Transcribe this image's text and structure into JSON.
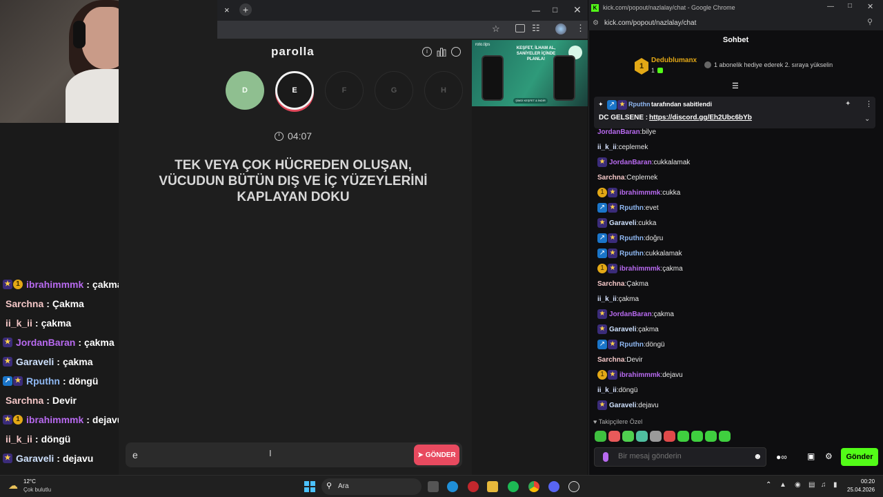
{
  "overlay_chat": [
    {
      "badges": [
        "star",
        "gold"
      ],
      "user": "ibrahimmmk",
      "color": "#b86af0",
      "message": "çakma"
    },
    {
      "badges": [],
      "user": "Sarchna",
      "color": "#f4c7c7",
      "message": "Çakma"
    },
    {
      "badges": [],
      "user": "ii_k_ii",
      "color": "#f4c7c7",
      "message": "çakma"
    },
    {
      "badges": [
        "star"
      ],
      "user": "JordanBaran",
      "color": "#b86af0",
      "message": "çakma"
    },
    {
      "badges": [
        "star"
      ],
      "user": "Garaveli",
      "color": "#cfe2ff",
      "message": "çakma"
    },
    {
      "badges": [
        "pin",
        "star"
      ],
      "user": "Rputhn",
      "color": "#8fb8f2",
      "message": "döngü"
    },
    {
      "badges": [],
      "user": "Sarchna",
      "color": "#f4c7c7",
      "message": "Devir"
    },
    {
      "badges": [
        "star",
        "gold"
      ],
      "user": "ibrahimmmk",
      "color": "#b86af0",
      "message": "dejavu"
    },
    {
      "badges": [],
      "user": "ii_k_ii",
      "color": "#f4c7c7",
      "message": "döngü"
    },
    {
      "badges": [
        "star"
      ],
      "user": "Garaveli",
      "color": "#cfe2ff",
      "message": "dejavu"
    }
  ],
  "overlay_separator": ":",
  "parolla": {
    "logo": "parolla",
    "letters": [
      {
        "label": "D",
        "state": "done"
      },
      {
        "label": "E",
        "state": "active"
      },
      {
        "label": "F",
        "state": "idle"
      },
      {
        "label": "G",
        "state": "idle"
      },
      {
        "label": "H",
        "state": "idle"
      }
    ],
    "timer": "04:07",
    "question": "TEK VEYA ÇOK HÜCREDEN OLUŞAN, VÜCUDUN BÜTÜN DIŞ VE İÇ YÜZEYLERİNİ KAPLAYAN DOKU",
    "answer_value": "e",
    "send_label": "GÖNDER",
    "ad_brand": "roto.tips",
    "ad_headline": "KEŞFET, İLHAM AL, SANİYELER İÇİNDE PLANLA!",
    "ad_cta": "ŞİMDİ KEŞFET & İNDİR"
  },
  "browser_tab": {
    "close": "×",
    "add": "+"
  },
  "kick": {
    "window_title": "kick.com/popout/nazlalay/chat - Google Chrome",
    "url": "kick.com/popout/nazlalay/chat",
    "header": "Sohbet",
    "leader": {
      "name": "Dedublumanx",
      "count": "1",
      "rank": "1",
      "text": "1 abonelik hediye ederek 2. sıraya yükselin"
    },
    "pinned": {
      "by_user": "Rputhn",
      "by_text": "tarafından sabitlendi",
      "prefix": "DC GELSENE : ",
      "link": "https://discord.gg/Eh2Ubc6bYb"
    },
    "partial_line": {
      "user": "JordanBaran",
      "message": "bilye"
    },
    "messages": [
      {
        "badges": [],
        "user": "ii_k_ii",
        "color": "#d7e3ff",
        "message": "ceplemek"
      },
      {
        "badges": [
          "star"
        ],
        "user": "JordanBaran",
        "color": "#b86af0",
        "message": "cukkalamak"
      },
      {
        "badges": [],
        "user": "Sarchna",
        "color": "#f4c7c7",
        "message": "Ceplemek"
      },
      {
        "badges": [
          "gold",
          "star"
        ],
        "user": "ibrahimmmk",
        "color": "#b86af0",
        "message": "cukka"
      },
      {
        "badges": [
          "pin",
          "star"
        ],
        "user": "Rputhn",
        "color": "#8fb8f2",
        "message": "evet"
      },
      {
        "badges": [
          "star"
        ],
        "user": "Garaveli",
        "color": "#cfe2ff",
        "message": "cukka"
      },
      {
        "badges": [
          "pin",
          "star"
        ],
        "user": "Rputhn",
        "color": "#8fb8f2",
        "message": "doğru"
      },
      {
        "badges": [
          "pin",
          "star"
        ],
        "user": "Rputhn",
        "color": "#8fb8f2",
        "message": "cukkalamak"
      },
      {
        "badges": [
          "gold",
          "star"
        ],
        "user": "ibrahimmmk",
        "color": "#b86af0",
        "message": "çakma"
      },
      {
        "badges": [],
        "user": "Sarchna",
        "color": "#f4c7c7",
        "message": "Çakma"
      },
      {
        "badges": [],
        "user": "ii_k_ii",
        "color": "#d7e3ff",
        "message": "çakma"
      },
      {
        "badges": [
          "star"
        ],
        "user": "JordanBaran",
        "color": "#b86af0",
        "message": "çakma"
      },
      {
        "badges": [
          "star"
        ],
        "user": "Garaveli",
        "color": "#cfe2ff",
        "message": "çakma"
      },
      {
        "badges": [
          "pin",
          "star"
        ],
        "user": "Rputhn",
        "color": "#8fb8f2",
        "message": "döngü"
      },
      {
        "badges": [],
        "user": "Sarchna",
        "color": "#f4c7c7",
        "message": "Devir"
      },
      {
        "badges": [
          "gold",
          "star"
        ],
        "user": "ibrahimmmk",
        "color": "#b86af0",
        "message": "dejavu"
      },
      {
        "badges": [],
        "user": "ii_k_ii",
        "color": "#d7e3ff",
        "message": "döngü"
      },
      {
        "badges": [
          "star"
        ],
        "user": "Garaveli",
        "color": "#cfe2ff",
        "message": "dejavu"
      }
    ],
    "emotes_label": "Takipçilere Özel",
    "emote_colors": [
      "#3fbf3f",
      "#e85a5a",
      "#4fd04f",
      "#4fbfa0",
      "#9a9a9a",
      "#e04a4a",
      "#3fcf3f",
      "#3fcf3f",
      "#3fcf3f",
      "#3fcf3f"
    ],
    "input_placeholder": "Bir mesaj gönderin",
    "send_label": "Gönder"
  },
  "taskbar": {
    "weather_temp": "12°C",
    "weather_desc": "Çok bulutlu",
    "search_label": "Ara",
    "time": "00:20",
    "date": "25.04.2026"
  },
  "colors": {
    "accent_kick": "#53fc18",
    "accent_parolla": "#e84a5f",
    "done_letter": "#8fbf90"
  }
}
